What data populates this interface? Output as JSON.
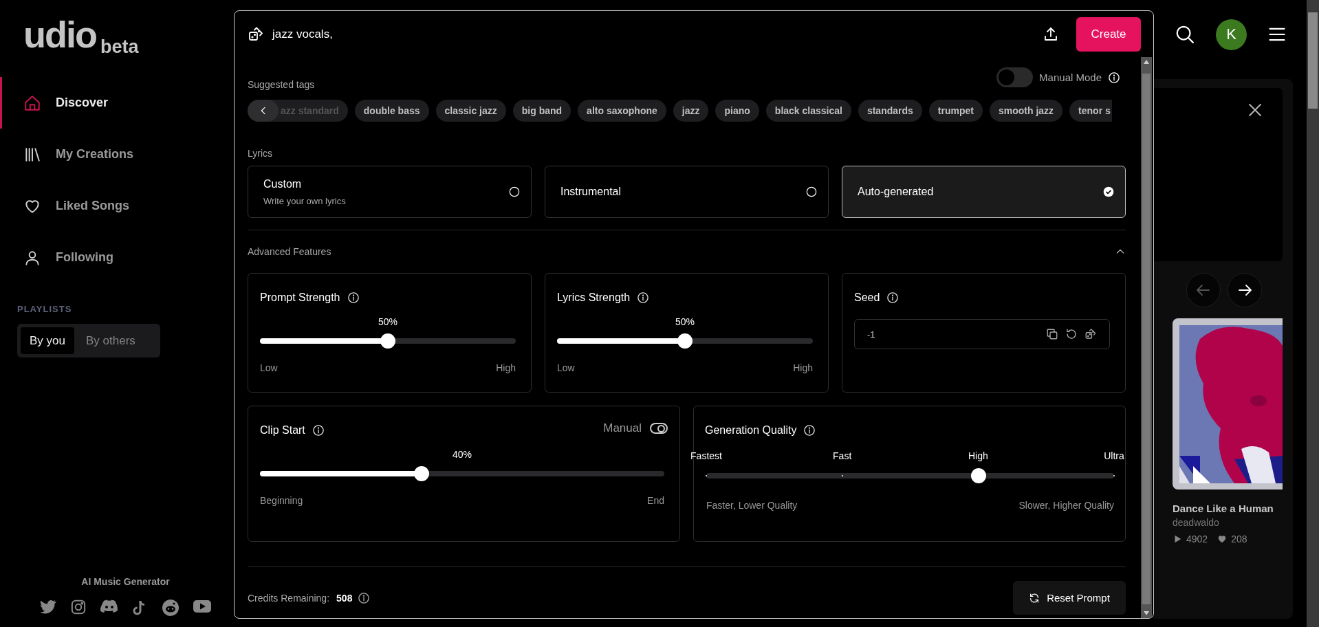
{
  "sidebar": {
    "logo": "udio",
    "logo_badge": "beta",
    "nav": [
      {
        "label": "Discover",
        "selected": true
      },
      {
        "label": "My Creations",
        "selected": false
      },
      {
        "label": "Liked Songs",
        "selected": false
      },
      {
        "label": "Following",
        "selected": false
      }
    ],
    "playlists_label": "PLAYLISTS",
    "playlist_tabs": [
      {
        "label": "By you",
        "selected": true
      },
      {
        "label": "By others",
        "selected": false
      }
    ],
    "footer": "AI Music Generator"
  },
  "header": {
    "avatar": "K"
  },
  "feature": {
    "song": {
      "title": "Dance Like a Human",
      "artist": "deadwaldo",
      "plays": "4902",
      "likes": "208"
    }
  },
  "modal": {
    "prompt": "jazz vocals,",
    "create": "Create",
    "manual_mode": {
      "label": "Manual Mode",
      "on": false
    },
    "suggested_tags_label": "Suggested tags",
    "tags": [
      "azz standard",
      "double bass",
      "classic jazz",
      "big band",
      "alto saxophone",
      "jazz",
      "piano",
      "black classical",
      "standards",
      "trumpet",
      "smooth jazz",
      "tenor s"
    ],
    "lyrics_label": "Lyrics",
    "lyrics_options": [
      {
        "title": "Custom",
        "subtitle": "Write your own lyrics",
        "selected": false
      },
      {
        "title": "Instrumental",
        "selected": false
      },
      {
        "title": "Auto-generated",
        "selected": true
      }
    ],
    "advanced": {
      "label": "Advanced Features",
      "expanded": true
    },
    "prompt_strength": {
      "title": "Prompt Strength",
      "reading": "50%",
      "level": 0.5,
      "min_label": "Low",
      "max_label": "High"
    },
    "lyrics_strength": {
      "title": "Lyrics Strength",
      "reading": "50%",
      "level": 0.5,
      "min_label": "Low",
      "max_label": "High"
    },
    "seed": {
      "title": "Seed",
      "value": "-1"
    },
    "clip_start": {
      "title": "Clip Start",
      "reading": "40%",
      "level": 0.4,
      "min_label": "Beginning",
      "max_label": "End",
      "manual": {
        "label": "Manual",
        "on": true
      }
    },
    "generation_quality": {
      "title": "Generation Quality",
      "stops": [
        "Fastest",
        "Fast",
        "High",
        "Ultra"
      ],
      "level": 0.667,
      "min_label": "Faster, Lower Quality",
      "max_label": "Slower, Higher Quality"
    },
    "credits": {
      "label": "Credits Remaining:",
      "value": "508"
    },
    "reset": "Reset Prompt"
  }
}
